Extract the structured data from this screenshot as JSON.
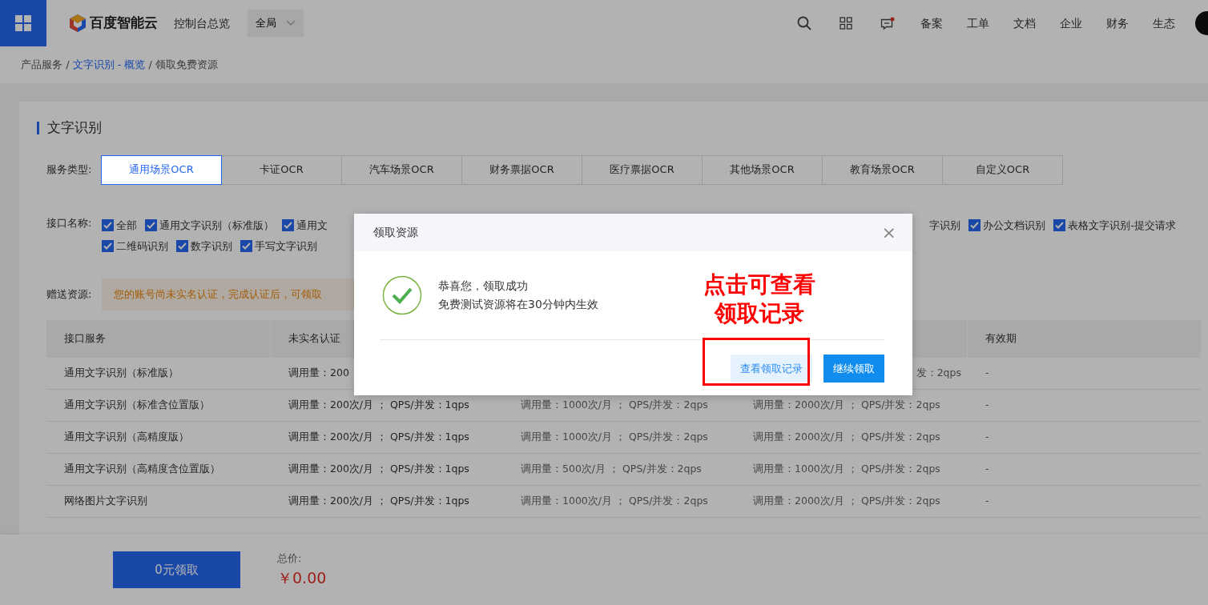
{
  "topbar": {
    "logo_text": "百度智能云",
    "console_link": "控制台总览",
    "region_select": {
      "value": "全局"
    },
    "message_unread": true,
    "nav_links": [
      "备案",
      "工单",
      "文档",
      "企业",
      "财务",
      "生态"
    ]
  },
  "breadcrumb": [
    {
      "label": "产品服务 /",
      "link": false
    },
    {
      "label": "文字识别 - 概览",
      "link": true
    },
    {
      "label": "/ 领取免费资源",
      "link": false
    }
  ],
  "section_title": "文字识别",
  "service_type": {
    "label": "服务类型:",
    "tabs": [
      {
        "label": "通用场景OCR",
        "selected": true
      },
      {
        "label": "卡证OCR",
        "selected": false
      },
      {
        "label": "汽车场景OCR",
        "selected": false
      },
      {
        "label": "财务票据OCR",
        "selected": false
      },
      {
        "label": "医疗票据OCR",
        "selected": false
      },
      {
        "label": "其他场景OCR",
        "selected": false
      },
      {
        "label": "教育场景OCR",
        "selected": false
      },
      {
        "label": "自定义OCR",
        "selected": false
      }
    ]
  },
  "interfaces": {
    "label": "接口名称:",
    "line_1_left": [
      {
        "label": "全部",
        "checked": true
      },
      {
        "label": "通用文字识别（标准版）",
        "checked": true
      },
      {
        "label": "通用文",
        "checked": true
      }
    ],
    "line_1_right": [
      {
        "label": "字识别"
      },
      {
        "label": "办公文档识别",
        "checked": true
      },
      {
        "label": "表格文字识别-提交请求",
        "checked": true
      }
    ],
    "line_2": [
      {
        "label": "二维码识别",
        "checked": true
      },
      {
        "label": "数字识别",
        "checked": true
      },
      {
        "label": "手写文字识别",
        "checked": true
      }
    ]
  },
  "gift": {
    "label": "赠送资源:",
    "notice": "您的账号尚未实名认证，完成认证后，可领取"
  },
  "table": {
    "columns": [
      {
        "label": "接口服务"
      },
      {
        "label": "未实名认证"
      },
      {},
      {},
      {
        "label": "有效期"
      }
    ],
    "rows": [
      {
        "cells": [
          {
            "text": "通用文字识别（标准版）"
          },
          {
            "text": "调用量：200"
          },
          {},
          {
            "text": "发：2qps",
            "cut_start": true
          },
          {
            "text": "-"
          }
        ]
      },
      {
        "cells": [
          {
            "text": "通用文字识别（标准含位置版）"
          },
          {
            "text": "调用量：200次/月 ； QPS/并发：1qps"
          },
          {
            "text": "调用量：1000次/月 ； QPS/并发：2qps"
          },
          {
            "text": "调用量：2000次/月 ； QPS/并发：2qps"
          },
          {
            "text": "-"
          }
        ]
      },
      {
        "cells": [
          {
            "text": "通用文字识别（高精度版）"
          },
          {
            "text": "调用量：200次/月 ； QPS/并发：1qps"
          },
          {
            "text": "调用量：1000次/月 ； QPS/并发：2qps"
          },
          {
            "text": "调用量：2000次/月 ； QPS/并发：2qps"
          },
          {
            "text": "-"
          }
        ]
      },
      {
        "cells": [
          {
            "text": "通用文字识别（高精度含位置版）"
          },
          {
            "text": "调用量：200次/月 ； QPS/并发：1qps"
          },
          {
            "text": "调用量：500次/月 ； QPS/并发：2qps"
          },
          {
            "text": "调用量：1000次/月 ； QPS/并发：2qps"
          },
          {
            "text": "-"
          }
        ]
      },
      {
        "cells": [
          {
            "text": "网络图片文字识别"
          },
          {
            "text": "调用量：200次/月 ； QPS/并发：1qps"
          },
          {
            "text": "调用量：1000次/月 ； QPS/并发：2qps"
          },
          {
            "text": "调用量：2000次/月 ； QPS/并发：2qps"
          },
          {
            "text": "-"
          }
        ]
      }
    ]
  },
  "footer": {
    "button": "0元领取",
    "total_label": "总价:",
    "total_value": "￥0.00"
  },
  "modal": {
    "title": "领取资源",
    "close": "×",
    "message": "恭喜您，领取成功",
    "detail": "免费测试资源将在30分钟内生效",
    "buttons": [
      {
        "label": "查看领取记录",
        "kind": "secondary"
      },
      {
        "label": "继续领取",
        "kind": "primary"
      }
    ]
  },
  "annotation": {
    "lines": [
      "点击可查看",
      "领取记录"
    ]
  }
}
